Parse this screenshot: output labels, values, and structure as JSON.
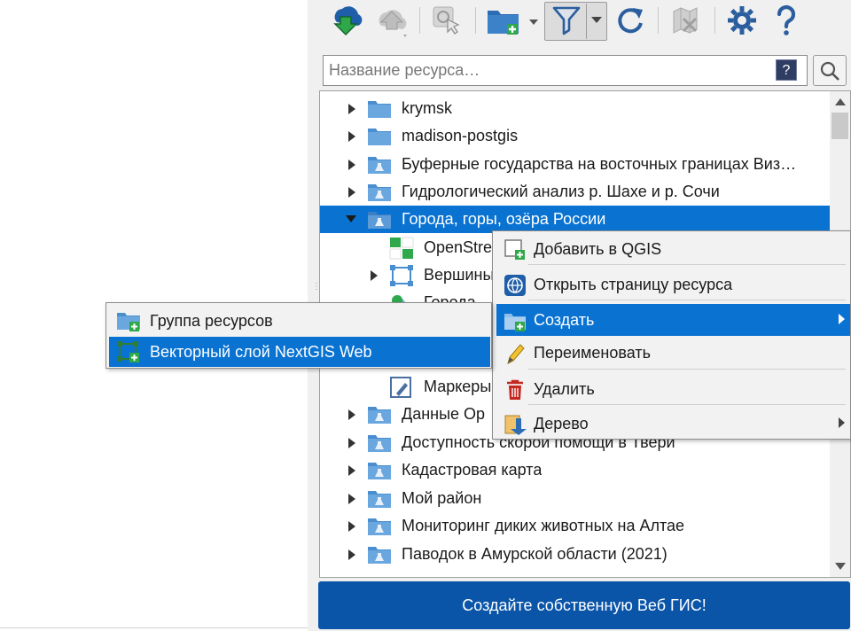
{
  "toolbar": {
    "buttons": [
      {
        "name": "download-icon",
        "enabled": true
      },
      {
        "name": "upload-icon",
        "enabled": false
      },
      {
        "name": "cursor-image-icon",
        "enabled": false
      },
      {
        "name": "new-folder-icon",
        "enabled": true
      },
      {
        "name": "filter-icon",
        "enabled": true,
        "pressed": true
      },
      {
        "name": "refresh-icon",
        "enabled": true
      },
      {
        "name": "delete-icon",
        "enabled": false
      },
      {
        "name": "settings-icon",
        "enabled": true
      },
      {
        "name": "help-icon",
        "enabled": true
      }
    ]
  },
  "search": {
    "placeholder": "Название ресурса…",
    "help_label": "?"
  },
  "tree": {
    "items": [
      {
        "label": "krymsk",
        "type": "folder",
        "expandable": true
      },
      {
        "label": "madison-postgis",
        "type": "folder",
        "expandable": true
      },
      {
        "label": "Буферные государства на восточных границах Виз…",
        "type": "folder-project",
        "expandable": true
      },
      {
        "label": "Гидрологический анализ р. Шахе и р. Сочи",
        "type": "folder-project",
        "expandable": true
      },
      {
        "label": "Города, горы, озёра России",
        "type": "folder-project",
        "expanded": true,
        "selected": true
      },
      {
        "label": "OpenStre",
        "type": "basemap",
        "child": true
      },
      {
        "label": "Вершины",
        "type": "vector",
        "child": true,
        "expandable": true
      },
      {
        "label": "Города",
        "type": "vector-style",
        "child": true
      },
      {
        "label": "Маркеры",
        "type": "style",
        "child": true
      },
      {
        "label": "Данные Ор",
        "type": "folder-project",
        "expandable": true
      },
      {
        "label": "Доступность скорой помощи в Твери",
        "type": "folder-project",
        "expandable": true
      },
      {
        "label": "Кадастровая карта",
        "type": "folder-project",
        "expandable": true
      },
      {
        "label": "Мой район",
        "type": "folder-project",
        "expandable": true
      },
      {
        "label": "Мониторинг диких животных на Алтае",
        "type": "folder-project",
        "expandable": true
      },
      {
        "label": "Паводок в Амурской области (2021)",
        "type": "folder-project",
        "expandable": true
      }
    ]
  },
  "context_menu": {
    "items": [
      {
        "label": "Добавить в QGIS",
        "icon": "add-to-qgis-icon"
      },
      {
        "label": "Открыть страницу ресурса",
        "icon": "globe-icon"
      },
      {
        "label": "Создать",
        "icon": "create-folder-icon",
        "submenu": true,
        "active": true
      },
      {
        "label": "Переименовать",
        "icon": "pencil-icon"
      },
      {
        "label": "Удалить",
        "icon": "trash-icon"
      },
      {
        "label": "Дерево",
        "icon": "tree-icon",
        "submenu": true
      }
    ]
  },
  "submenu": {
    "items": [
      {
        "label": "Группа ресурсов",
        "icon": "resource-group-icon"
      },
      {
        "label": "Векторный слой NextGIS Web",
        "icon": "vector-layer-add-icon",
        "active": true
      }
    ]
  },
  "footer": {
    "create_gis_label": "Создайте собственную Веб ГИС!"
  },
  "colors": {
    "selection": "#0a73d2",
    "folder": "#5b9bd5",
    "footer_button": "#0b55a8"
  }
}
